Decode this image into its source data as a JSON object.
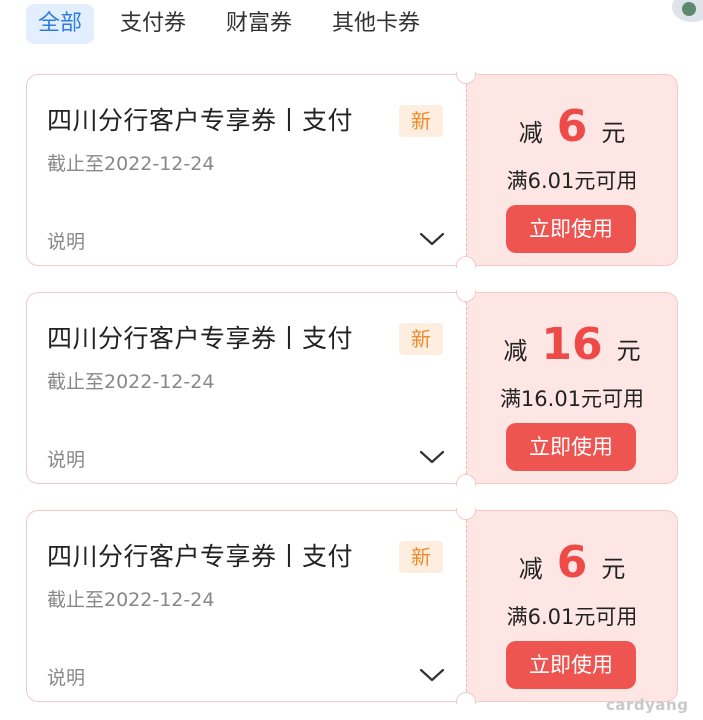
{
  "tabs": [
    {
      "label": "全部",
      "active": true
    },
    {
      "label": "支付券",
      "active": false
    },
    {
      "label": "财富券",
      "active": false
    },
    {
      "label": "其他卡券",
      "active": false
    }
  ],
  "coupons": [
    {
      "title": "四川分行客户专享券丨支付",
      "badge": "新",
      "expiry": "截止至2022-12-24",
      "desc_label": "说明",
      "prefix": "减",
      "amount": "6",
      "suffix": "元",
      "condition": "满6.01元可用",
      "button": "立即使用"
    },
    {
      "title": "四川分行客户专享券丨支付",
      "badge": "新",
      "expiry": "截止至2022-12-24",
      "desc_label": "说明",
      "prefix": "减",
      "amount": "16",
      "suffix": "元",
      "condition": "满16.01元可用",
      "button": "立即使用"
    },
    {
      "title": "四川分行客户专享券丨支付",
      "badge": "新",
      "expiry": "截止至2022-12-24",
      "desc_label": "说明",
      "prefix": "减",
      "amount": "6",
      "suffix": "元",
      "condition": "满6.01元可用",
      "button": "立即使用"
    }
  ],
  "watermark": "cardyang",
  "colors": {
    "accent_blue": "#2f7de1",
    "accent_red": "#ee4b48",
    "badge_orange": "#f08a2a",
    "coupon_pink": "#fde6e4"
  }
}
